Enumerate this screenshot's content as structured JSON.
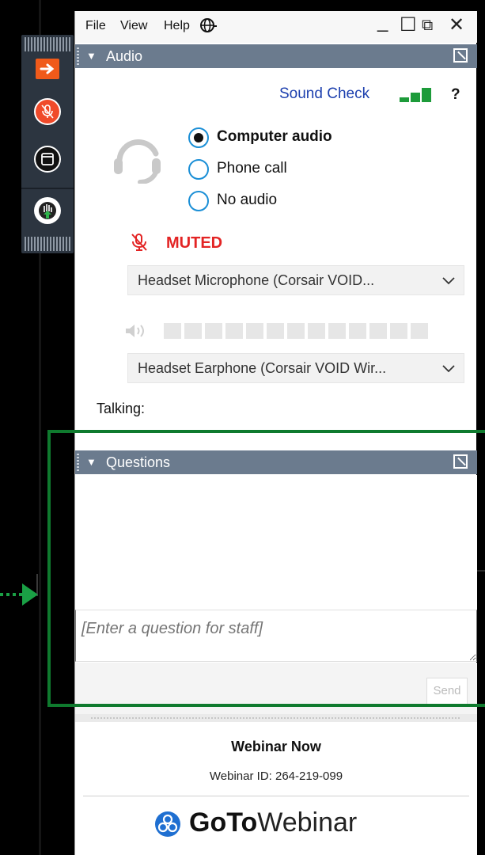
{
  "menu": {
    "file": "File",
    "view": "View",
    "help": "Help"
  },
  "window_controls": {
    "minimize": "_",
    "maximize": "☐",
    "popout": "⧉",
    "close": "✕"
  },
  "audio": {
    "section_title": "Audio",
    "sound_check": "Sound Check",
    "help_mark": "?",
    "options": [
      {
        "label": "Computer audio",
        "selected": true
      },
      {
        "label": "Phone call",
        "selected": false
      },
      {
        "label": "No audio",
        "selected": false
      }
    ],
    "mic_status": "MUTED",
    "microphone": "Headset Microphone (Corsair VOID...",
    "speaker": "Headset Earphone (Corsair VOID Wir...",
    "talking_label": "Talking:",
    "speaker_level": 0
  },
  "questions": {
    "section_title": "Questions",
    "input_placeholder": "[Enter a question for staff]",
    "send_label": "Send"
  },
  "footer": {
    "webinar_name": "Webinar Now",
    "webinar_id": "Webinar ID: 264-219-099",
    "brand_bold": "GoTo",
    "brand_light": "Webinar"
  },
  "icons": [
    "arrow-right-icon",
    "microphone-muted-icon",
    "screen-icon",
    "raise-hand-icon",
    "globe-icon",
    "headset-icon",
    "speaker-icon",
    "chevron-down-icon",
    "popout-icon",
    "gotowebinar-logo-icon"
  ],
  "colors": {
    "accent_blue": "#1c3fae",
    "muted_red": "#e32424",
    "section_bar": "#6b7b8e",
    "signal_green": "#1d9b3a",
    "annotation_green": "#0f7a2e"
  }
}
